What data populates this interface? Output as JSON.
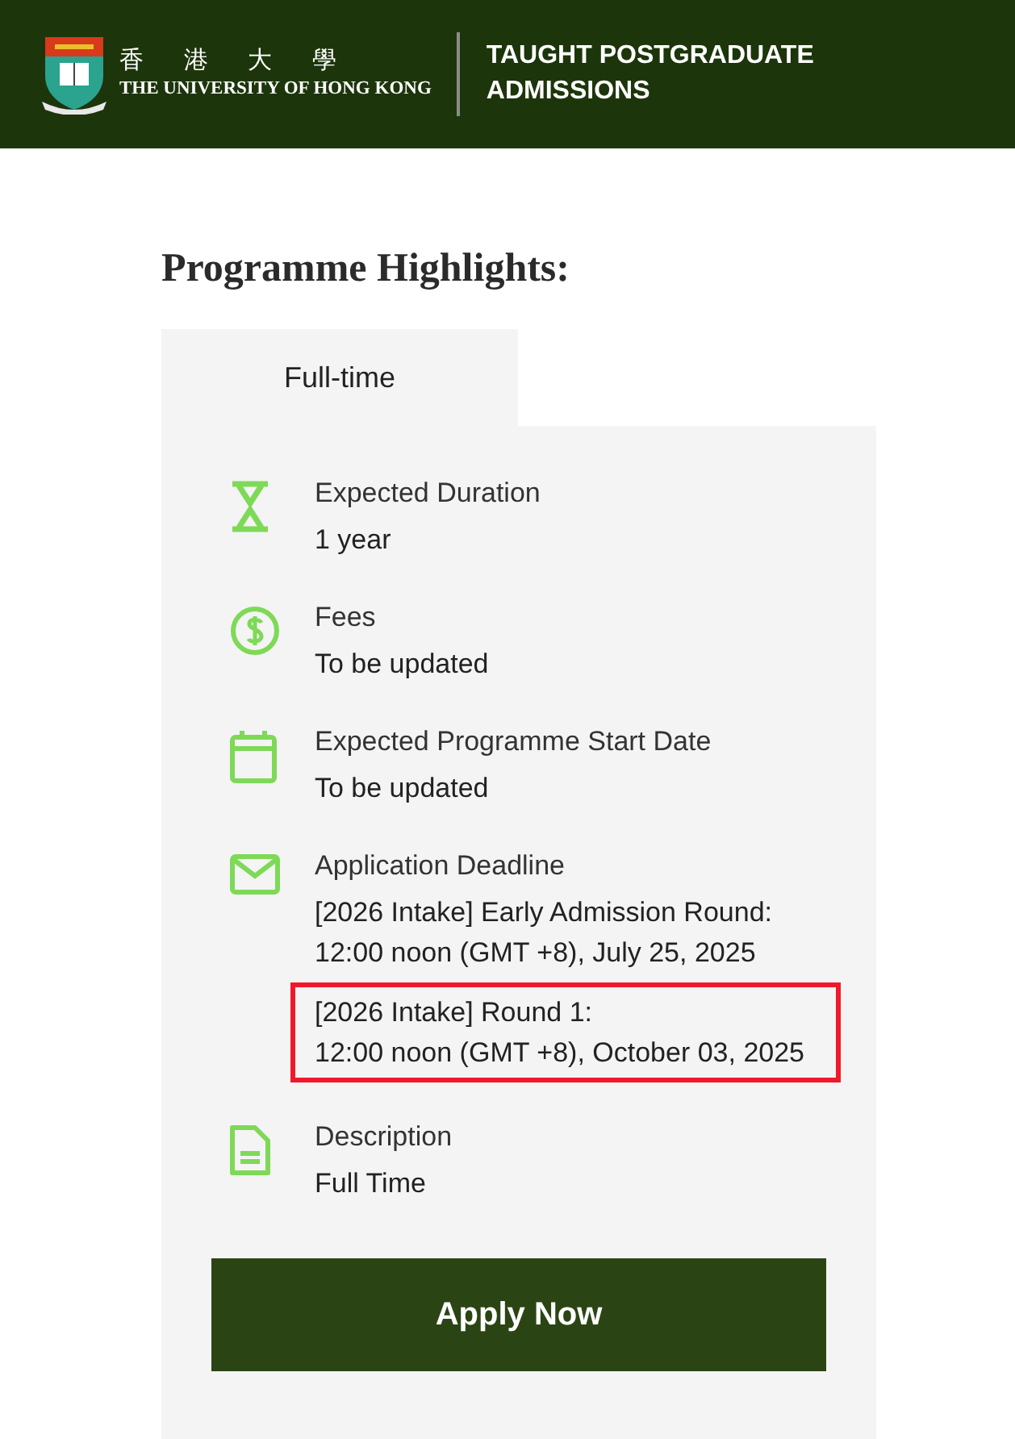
{
  "header": {
    "logo_chinese": "香 港 大 學",
    "logo_english": "THE UNIVERSITY OF HONG KONG",
    "section_title": [
      "TAUGHT POSTGRADUATE",
      "ADMISSIONS"
    ]
  },
  "heading": "Programme Highlights:",
  "tabs": [
    {
      "label": "Full-time",
      "selected": true
    }
  ],
  "highlights": [
    {
      "kind": "duration",
      "label": "Expected Duration",
      "values": [
        {
          "lines": [
            "1 year"
          ],
          "highlighted": false
        }
      ]
    },
    {
      "kind": "fees",
      "label": "Fees",
      "values": [
        {
          "lines": [
            "To be updated"
          ],
          "highlighted": false
        }
      ]
    },
    {
      "kind": "start",
      "label": "Expected Programme Start Date",
      "values": [
        {
          "lines": [
            "To be updated"
          ],
          "highlighted": false
        }
      ]
    },
    {
      "kind": "deadline",
      "label": "Application Deadline",
      "values": [
        {
          "lines": [
            "[2026 Intake] Early Admission Round:",
            "12:00 noon (GMT +8), July 25, 2025"
          ],
          "highlighted": false
        },
        {
          "lines": [
            "[2026 Intake] Round 1:",
            "12:00 noon (GMT +8), October 03, 2025"
          ],
          "highlighted": true
        }
      ]
    },
    {
      "kind": "description",
      "label": "Description",
      "values": [
        {
          "lines": [
            "Full Time"
          ],
          "highlighted": false
        }
      ]
    }
  ],
  "apply_button": "Apply Now"
}
